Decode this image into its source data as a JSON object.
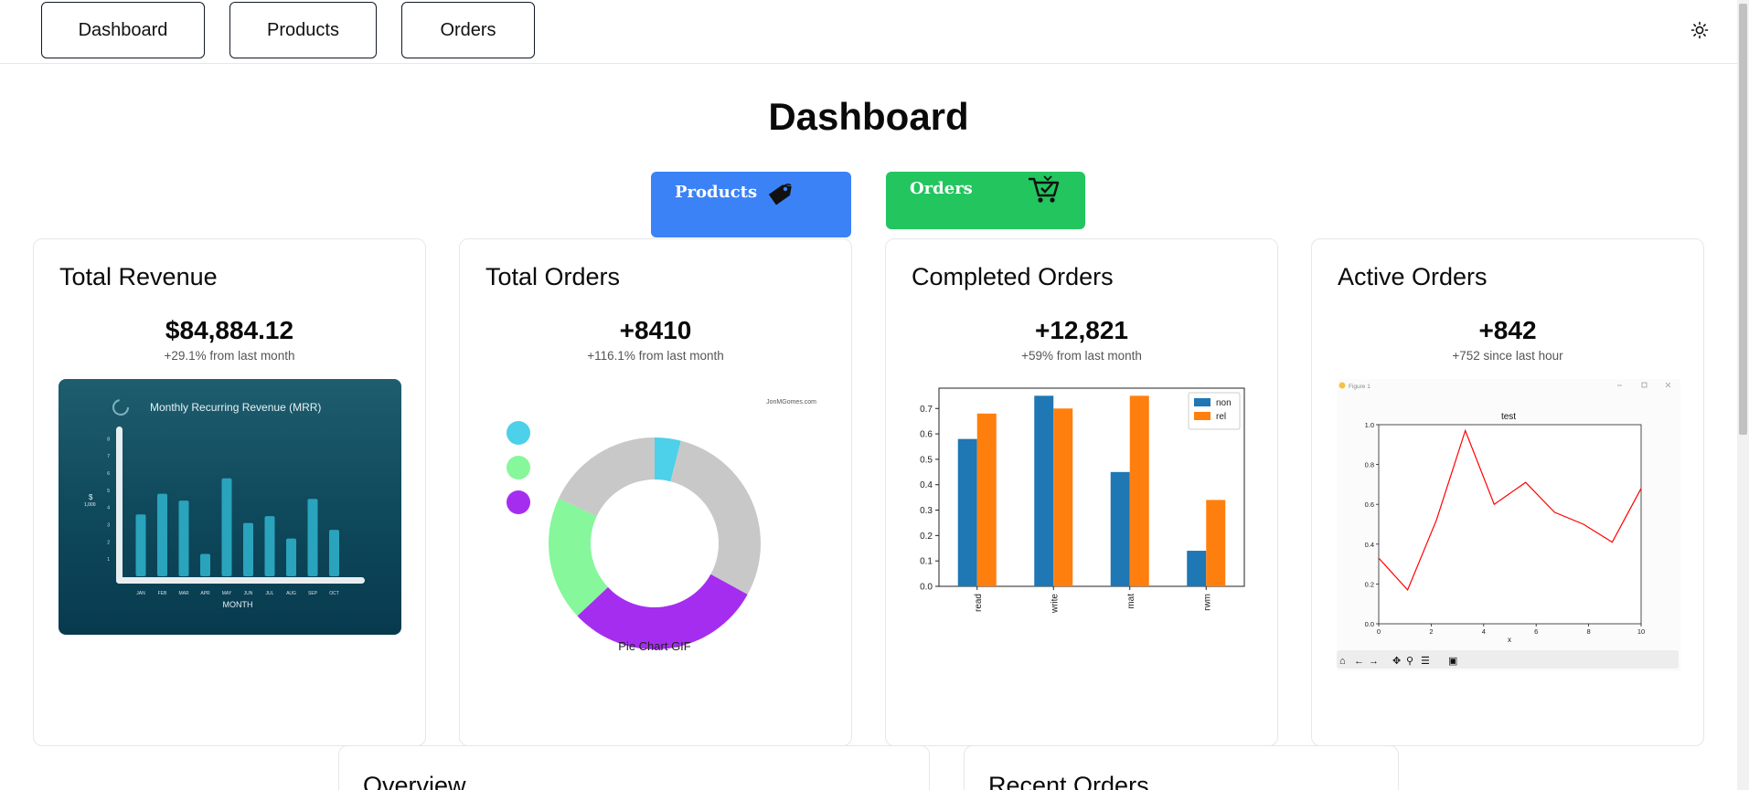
{
  "nav": {
    "items": [
      {
        "label": "Dashboard"
      },
      {
        "label": "Products"
      },
      {
        "label": "Orders"
      }
    ]
  },
  "page": {
    "title": "Dashboard"
  },
  "quick_actions": {
    "products": {
      "label": "Products",
      "color": "#3b82f6"
    },
    "orders": {
      "label": "Orders",
      "color": "#22c55e"
    }
  },
  "cards": [
    {
      "title": "Total Revenue",
      "value": "$84,884.12",
      "sub": "+29.1% from last month"
    },
    {
      "title": "Total Orders",
      "value": "+8410",
      "sub": "+116.1% from last month"
    },
    {
      "title": "Completed Orders",
      "value": "+12,821",
      "sub": "+59% from last month"
    },
    {
      "title": "Active Orders",
      "value": "+842",
      "sub": "+752 since last hour"
    }
  ],
  "lower_cards": [
    {
      "title": "Overview"
    },
    {
      "title": "Recent Orders"
    }
  ],
  "icons": {
    "theme": "sun-icon",
    "products": "price-tag-icon",
    "orders": "shopping-cart-icon"
  },
  "chart_data": [
    {
      "type": "bar",
      "title": "Monthly Recurring Revenue (MRR)",
      "xlabel": "MONTH",
      "ylabel": "$",
      "ylabel_unit": "1,000",
      "categories": [
        "JAN",
        "FEB",
        "MAR",
        "APR",
        "MAY",
        "JUN",
        "JUL",
        "AUG",
        "SEP",
        "OCT"
      ],
      "values": [
        3.6,
        4.8,
        4.4,
        1.3,
        5.7,
        3.1,
        3.5,
        2.2,
        4.5,
        2.7
      ],
      "yticks": [
        "1",
        "2",
        "3",
        "4",
        "5",
        "6",
        "7",
        "8"
      ],
      "ylim": [
        0,
        8.5
      ],
      "colors": {
        "bar": "#2aa3bd",
        "axis": "#e8eef0"
      }
    },
    {
      "type": "pie",
      "title": "",
      "watermark": "JonMGomes.com",
      "caption": "Pie Chart GIF",
      "donut": true,
      "slices": [
        {
          "value": 4,
          "color": "#4dd0ea"
        },
        {
          "value": 29,
          "color": "#c8c8c8"
        },
        {
          "value": 30,
          "color": "#a52df0"
        },
        {
          "value": 19,
          "color": "#86f79a"
        },
        {
          "value": 18,
          "color": "#c8c8c8"
        }
      ],
      "legend_dots": [
        "#4dd0ea",
        "#86f79a",
        "#a52df0"
      ]
    },
    {
      "type": "bar",
      "title": "",
      "categories": [
        "read",
        "write",
        "mat",
        "rwm"
      ],
      "series": [
        {
          "name": "non",
          "values": [
            0.58,
            0.75,
            0.45,
            0.14
          ],
          "color": "#1f77b4"
        },
        {
          "name": "rel",
          "values": [
            0.68,
            0.7,
            0.75,
            0.34
          ],
          "color": "#ff7f0e"
        }
      ],
      "yticks": [
        "0.0",
        "0.1",
        "0.2",
        "0.3",
        "0.4",
        "0.5",
        "0.6",
        "0.7"
      ],
      "ylim": [
        0,
        0.78
      ],
      "legend": "top-right"
    },
    {
      "type": "line",
      "window_title": "Figure 1",
      "title": "test",
      "xlabel": "x",
      "x": [
        0,
        1.1,
        2.2,
        3.3,
        4.4,
        5.6,
        6.7,
        7.8,
        8.9,
        10
      ],
      "y": [
        0.33,
        0.17,
        0.52,
        0.97,
        0.6,
        0.71,
        0.56,
        0.5,
        0.41,
        0.68
      ],
      "xticks": [
        "0",
        "2",
        "4",
        "6",
        "8",
        "10"
      ],
      "yticks": [
        "0.0",
        "0.2",
        "0.4",
        "0.6",
        "0.8",
        "1.0"
      ],
      "xlim": [
        0,
        10
      ],
      "ylim": [
        0,
        1.0
      ],
      "color": "#ff0000"
    }
  ]
}
